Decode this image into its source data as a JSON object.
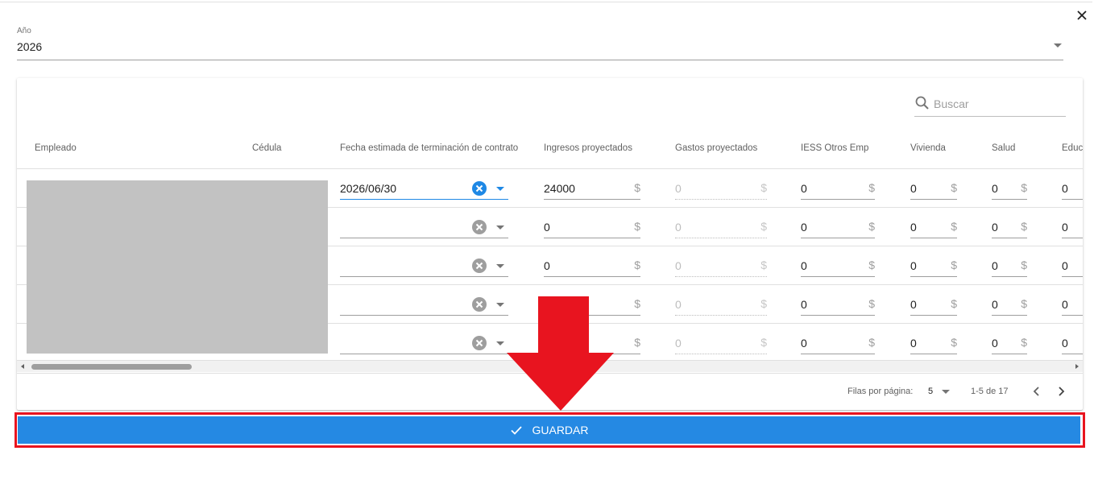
{
  "dialog": {
    "close_icon": "close-icon"
  },
  "year": {
    "label": "Año",
    "value": "2026"
  },
  "search": {
    "placeholder": "Buscar",
    "icon": "search-icon"
  },
  "table": {
    "columns": [
      "Empleado",
      "Cédula",
      "Fecha estimada de terminación de contrato",
      "Ingresos proyectados",
      "Gastos proyectados",
      "IESS Otros Emp",
      "Vivienda",
      "Salud",
      "Educa"
    ],
    "currency_symbol": "$",
    "rows": [
      {
        "fecha": "2026/06/30",
        "ingresos": "24000",
        "gastos": "0",
        "iess": "0",
        "vivienda": "0",
        "salud": "0",
        "educa": "0"
      },
      {
        "fecha": "",
        "ingresos": "0",
        "gastos": "0",
        "iess": "0",
        "vivienda": "0",
        "salud": "0",
        "educa": "0"
      },
      {
        "fecha": "",
        "ingresos": "0",
        "gastos": "0",
        "iess": "0",
        "vivienda": "0",
        "salud": "0",
        "educa": "0"
      },
      {
        "fecha": "",
        "ingresos": "",
        "gastos": "0",
        "iess": "0",
        "vivienda": "0",
        "salud": "0",
        "educa": "0"
      },
      {
        "fecha": "",
        "ingresos": "",
        "gastos": "0",
        "iess": "0",
        "vivienda": "0",
        "salud": "0",
        "educa": "0"
      }
    ]
  },
  "pagination": {
    "rows_per_page_label": "Filas por página:",
    "rows_per_page": "5",
    "range": "1-5 de 17"
  },
  "actions": {
    "save_label": "GUARDAR"
  },
  "colors": {
    "primary": "#2589e3",
    "annotation_red": "#e8141f",
    "active_input": "#1e88e5",
    "redaction": "#c2c2c2"
  }
}
